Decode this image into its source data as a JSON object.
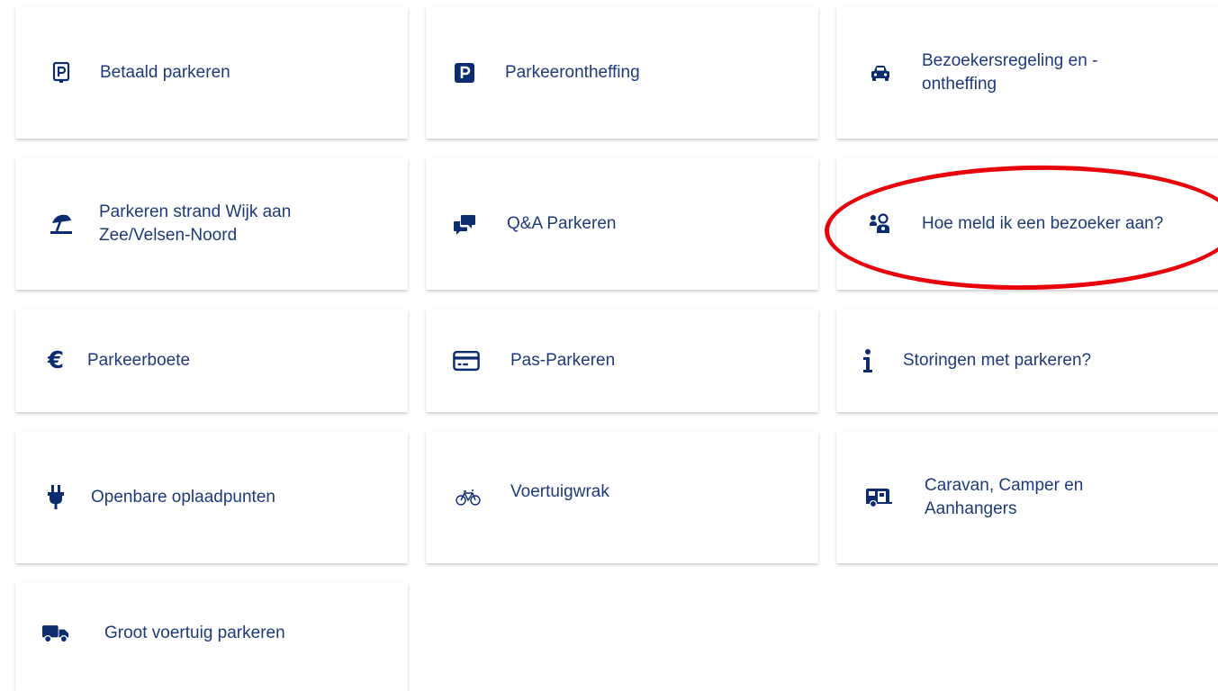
{
  "theme": {
    "icon_color": "#0b2c6f",
    "text_color": "#1e3a7b",
    "annotation_color": "#e8000b"
  },
  "tiles": [
    {
      "label": "Betaald parkeren",
      "icon": "parking-meter-icon"
    },
    {
      "label": "Parkeerontheffing",
      "icon": "parking-sign-icon"
    },
    {
      "label": "Bezoekersregeling en - ontheffing",
      "icon": "car-icon"
    },
    {
      "label": "Parkeren strand Wijk aan Zee/Velsen-Noord",
      "icon": "beach-umbrella-icon"
    },
    {
      "label": "Q&A Parkeren",
      "icon": "chat-bubbles-icon"
    },
    {
      "label": "Hoe meld ik een bezoeker aan?",
      "icon": "visitor-icon"
    },
    {
      "label": "Parkeerboete",
      "icon": "euro-icon"
    },
    {
      "label": "Pas-Parkeren",
      "icon": "credit-card-icon"
    },
    {
      "label": "Storingen met parkeren?",
      "icon": "info-icon"
    },
    {
      "label": "Openbare oplaadpunten",
      "icon": "plug-icon"
    },
    {
      "label": "Voertuigwrak",
      "icon": "bicycle-icon"
    },
    {
      "label": "Caravan, Camper en Aanhangers",
      "icon": "caravan-icon"
    },
    {
      "label": "Groot voertuig parkeren",
      "icon": "truck-icon"
    }
  ]
}
